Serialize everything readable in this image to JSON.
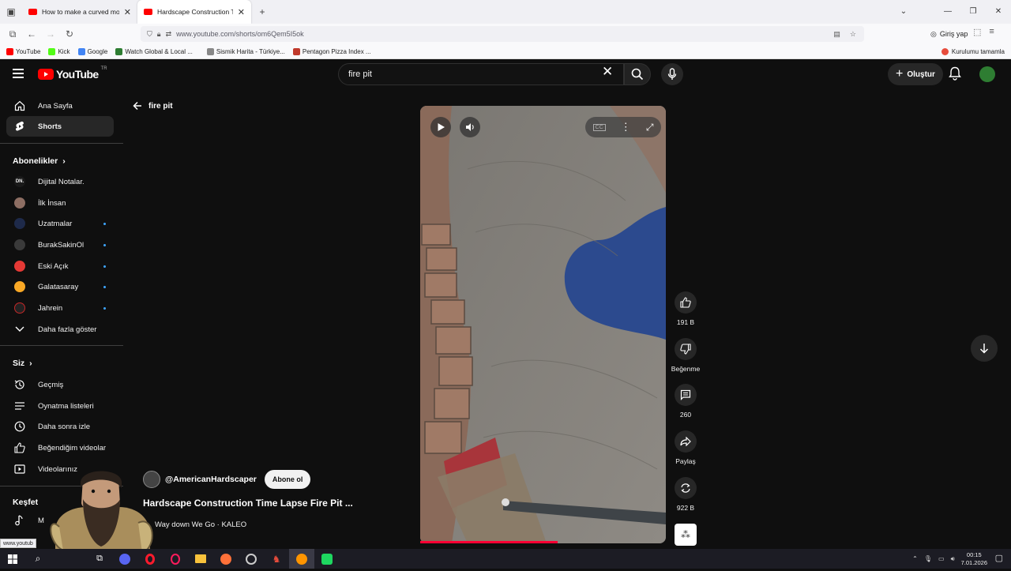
{
  "browser": {
    "tabs": [
      {
        "title": "How to make a curved modern",
        "active": false
      },
      {
        "title": "Hardscape Construction Time L",
        "active": true
      }
    ],
    "new_tab": "+",
    "url": "www.youtube.com/shorts/om6Qem5I5ok",
    "signin_label": "Giriş yap",
    "bookmarks": [
      "YouTube",
      "Kick",
      "Google",
      "Watch Global & Local ...",
      "Sismik Harita - Türkiye...",
      "Pentagon Pizza Index ..."
    ],
    "bookmark_colors": [
      "#ff0000",
      "#53fc18",
      "#4285f4",
      "#2e7d32",
      "#888888",
      "#c0392b"
    ],
    "bookmark_right": "Kurulumu tamamla",
    "status_url": "www.youtub"
  },
  "header": {
    "logo_text": "YouTube",
    "logo_region": "TR",
    "search_value": "fire pit",
    "create_label": "Oluştur"
  },
  "sidebar": {
    "home": "Ana Sayfa",
    "shorts": "Shorts",
    "subs_title": "Abonelikler",
    "channels": [
      {
        "name": "Dijital Notalar.",
        "color": "#1a1a1a",
        "dot": false
      },
      {
        "name": "İlk İnsan",
        "color": "#8d6e63",
        "dot": false
      },
      {
        "name": "Uzatmalar",
        "color": "#1e2a4a",
        "dot": true
      },
      {
        "name": "BurakSakinOl",
        "color": "#3a3a3a",
        "dot": true
      },
      {
        "name": "Eski Açık",
        "color": "#e53935",
        "dot": true
      },
      {
        "name": "Galatasaray",
        "color": "#f9a825",
        "dot": true
      },
      {
        "name": "Jahrein",
        "color": "#222222",
        "dot": true
      }
    ],
    "show_more": "Daha fazla göster",
    "you_title": "Siz",
    "you_items": [
      "Geçmiş",
      "Oynatma listeleri",
      "Daha sonra izle",
      "Beğendiğim videolar",
      "Videolarınız"
    ],
    "explore_title": "Keşfet",
    "explore_item": "M"
  },
  "main": {
    "back_label": "fire pit",
    "channel_name": "@AmericanHardscaper",
    "subscribe_label": "Abone ol",
    "video_title": "Hardscape Construction Time Lapse Fire Pit ...",
    "music": "Way down We Go · KALEO",
    "progress": 0.56
  },
  "actions": [
    {
      "name": "like",
      "label": "191 B"
    },
    {
      "name": "dislike",
      "label": "Beğenme"
    },
    {
      "name": "comments",
      "label": "260"
    },
    {
      "name": "share",
      "label": "Paylaş"
    },
    {
      "name": "remix",
      "label": "922 B"
    }
  ],
  "taskbar": {
    "time": "00:15",
    "date": "7.01.2026"
  }
}
